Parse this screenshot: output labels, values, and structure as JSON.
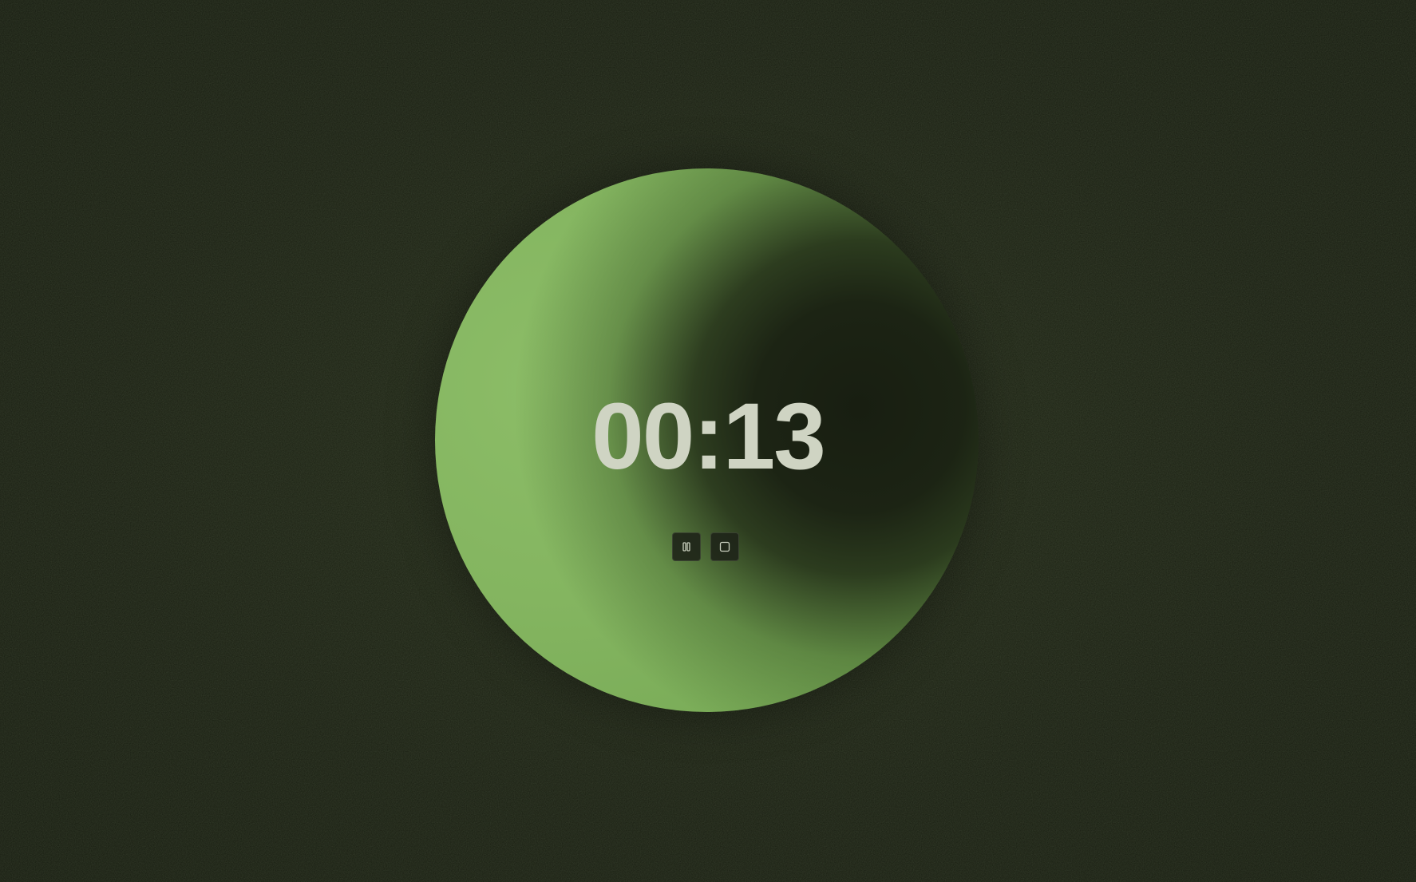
{
  "timer": {
    "display": "00:13"
  },
  "controls": {
    "pause_icon": "pause-icon",
    "stop_icon": "stop-icon"
  },
  "colors": {
    "background": "#1a1f12",
    "orb_light": "#84b560",
    "orb_dark": "#181e11",
    "time_text": "#cfd4c3"
  }
}
